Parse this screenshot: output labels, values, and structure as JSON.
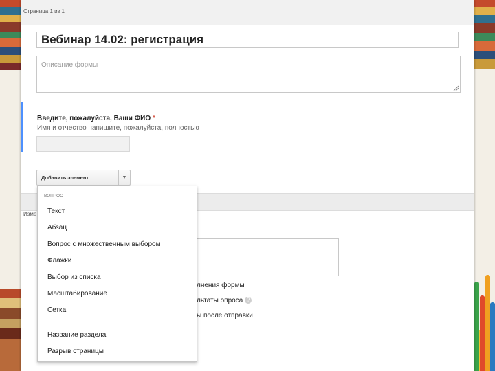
{
  "topbar": {
    "page_indicator": "Страница 1 из 1"
  },
  "form": {
    "title": "Вебинар  14.02: регистрация",
    "description_placeholder": "Описание формы"
  },
  "question": {
    "title": "Введите, пожалуйста, Ваши ФИО",
    "required_mark": "*",
    "help_text": "Имя и отчество напишите, пожалуйста, полностью"
  },
  "add_element": {
    "label": "Добавить элемент",
    "arrow": "▼"
  },
  "confirmation": {
    "label": "Изме",
    "options": [
      "лнения формы",
      "льтаты опроса",
      "ы после отправки"
    ],
    "help_icon": "?"
  },
  "menu": {
    "header": "ВОПРОС",
    "question_items": [
      "Текст",
      "Абзац",
      "Вопрос с множественным выбором",
      "Флажки",
      "Выбор из списка",
      "Масштабирование",
      "Сетка"
    ],
    "layout_items": [
      "Название раздела",
      "Разрыв страницы"
    ]
  },
  "colors": {
    "accent": "#4d90fe",
    "required": "#d14836"
  }
}
